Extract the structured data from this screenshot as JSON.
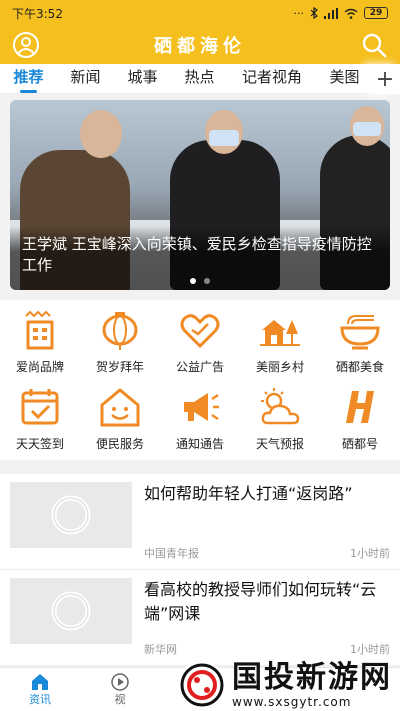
{
  "status": {
    "time": "下午3:52",
    "dots": "···",
    "battery": "29"
  },
  "header": {
    "title": "硒都海伦",
    "profile_icon": "user-icon",
    "search_icon": "search-icon"
  },
  "tabs": [
    {
      "label": "推荐"
    },
    {
      "label": "新闻"
    },
    {
      "label": "城事"
    },
    {
      "label": "热点"
    },
    {
      "label": "记者视角"
    },
    {
      "label": "美图"
    }
  ],
  "tabs_add": "+",
  "banner": {
    "caption": "王学斌 王宝峰深入向荣镇、爱民乡检查指导疫情防控工作",
    "slide_count": 2,
    "active_slide": 1
  },
  "services": [
    {
      "label": "爱尚品牌",
      "icon": "brand-building-icon"
    },
    {
      "label": "贺岁拜年",
      "icon": "lantern-icon"
    },
    {
      "label": "公益广告",
      "icon": "heart-hands-icon"
    },
    {
      "label": "美丽乡村",
      "icon": "village-icon"
    },
    {
      "label": "硒都美食",
      "icon": "noodle-bowl-icon"
    },
    {
      "label": "天天签到",
      "icon": "calendar-check-icon"
    },
    {
      "label": "便民服务",
      "icon": "smile-house-icon"
    },
    {
      "label": "通知通告",
      "icon": "megaphone-icon"
    },
    {
      "label": "天气预报",
      "icon": "weather-icon"
    },
    {
      "label": "硒都号",
      "icon": "h-logo-icon"
    }
  ],
  "news": [
    {
      "title": "如何帮助年轻人打通“返岗路”",
      "source": "中国青年报",
      "time": "1小时前"
    },
    {
      "title": "看高校的教授导师们如何玩转“云端”网课",
      "source": "新华网",
      "time": "1小时前"
    }
  ],
  "bottom_nav": [
    {
      "label": "资讯",
      "icon": "home-icon",
      "active": true
    },
    {
      "label": "视",
      "icon": "video-icon",
      "active": false
    }
  ],
  "watermark": {
    "title": "国投新游网",
    "url": "www.sxsgytr.com"
  },
  "colors": {
    "brand_yellow": "#f5bf1e",
    "accent_blue": "#1a8ad8",
    "icon_orange": "#f08a24"
  }
}
